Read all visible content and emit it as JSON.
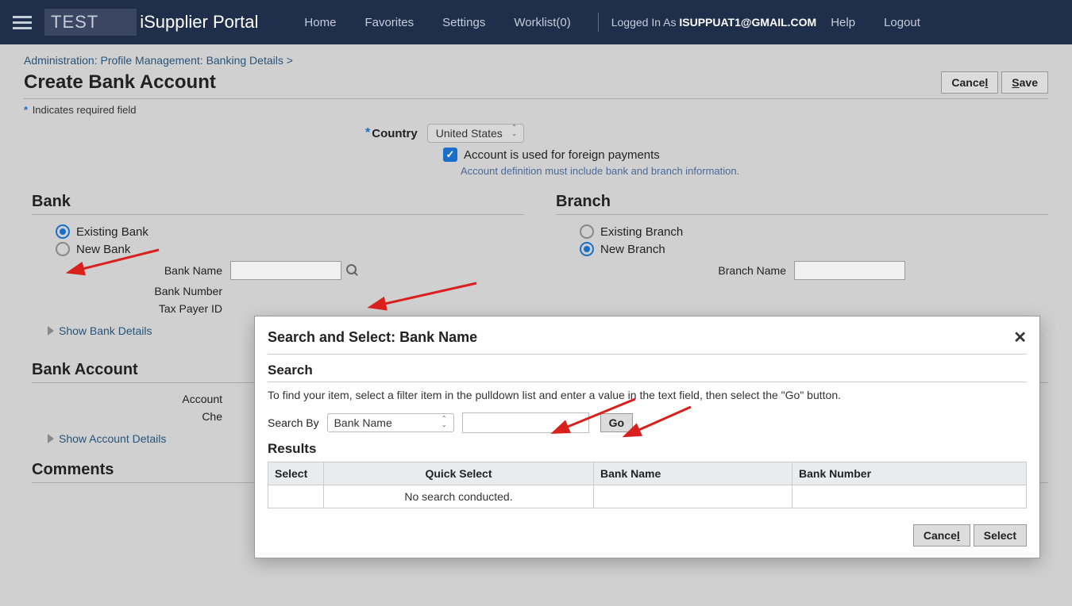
{
  "topbar": {
    "brand_env": "TEST",
    "brand_name": "iSupplier Portal",
    "nav": {
      "home": "Home",
      "favorites": "Favorites",
      "settings": "Settings",
      "worklist": "Worklist(0)"
    },
    "logged_in_prefix": "Logged In As ",
    "logged_in_user": "ISUPPUAT1@GMAIL.COM",
    "help": "Help",
    "logout": "Logout"
  },
  "breadcrumb": {
    "part1": "Administration:",
    "part2": "Profile Management:",
    "part3": "Banking Details",
    "sep": ">"
  },
  "page": {
    "title": "Create Bank Account",
    "cancel": "Cancel",
    "save": "Save",
    "required_note": "Indicates required field"
  },
  "form": {
    "country_label": "Country",
    "country_value": "United States",
    "foreign_checkbox_label": "Account is used for foreign payments",
    "foreign_helper": "Account definition must include bank and branch information."
  },
  "bank": {
    "heading": "Bank",
    "existing": "Existing Bank",
    "new": "New Bank",
    "name_label": "Bank Name",
    "number_label": "Bank Number",
    "tax_label": "Tax Payer ID",
    "show_details": "Show Bank Details"
  },
  "branch": {
    "heading": "Branch",
    "existing": "Existing Branch",
    "new": "New Branch",
    "name_label": "Branch Name"
  },
  "account": {
    "heading": "Bank Account",
    "row1": "Account",
    "row2": "Che",
    "show_details": "Show Account Details"
  },
  "comments": {
    "heading": "Comments"
  },
  "modal": {
    "title": "Search and Select: Bank Name",
    "search_heading": "Search",
    "instructions": "To find your item, select a filter item in the pulldown list and enter a value in the text field, then select the \"Go\" button.",
    "search_by_label": "Search By",
    "search_by_value": "Bank Name",
    "go": "Go",
    "results_heading": "Results",
    "columns": {
      "select": "Select",
      "quick_select": "Quick Select",
      "bank_name": "Bank Name",
      "bank_number": "Bank Number"
    },
    "no_results": "No search conducted.",
    "cancel": "Cancel",
    "select_btn": "Select"
  }
}
